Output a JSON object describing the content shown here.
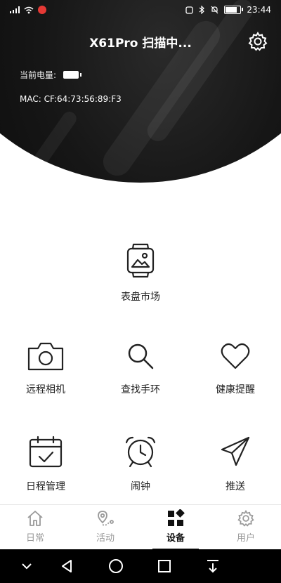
{
  "status_bar": {
    "left_icons": [
      "signal-icon",
      "wifi-icon",
      "notification-icon"
    ],
    "right_icons": [
      "nfc-icon",
      "bluetooth-icon",
      "mute-icon",
      "battery-icon"
    ],
    "time": "23:44"
  },
  "header": {
    "title": "X61Pro 扫描中...",
    "battery_label": "当前电量:",
    "mac": "MAC: CF:64:73:56:89:F3"
  },
  "features": [
    {
      "label": "表盘市场",
      "icon": "watch-face-icon"
    },
    {
      "label": "远程相机",
      "icon": "camera-icon"
    },
    {
      "label": "查找手环",
      "icon": "search-icon"
    },
    {
      "label": "健康提醒",
      "icon": "heart-icon"
    },
    {
      "label": "日程管理",
      "icon": "calendar-icon"
    },
    {
      "label": "闹钟",
      "icon": "alarm-clock-icon"
    },
    {
      "label": "推送",
      "icon": "send-icon"
    }
  ],
  "tabs": [
    {
      "label": "日常",
      "icon": "home-icon",
      "active": false
    },
    {
      "label": "活动",
      "icon": "route-icon",
      "active": false
    },
    {
      "label": "设备",
      "icon": "device-grid-icon",
      "active": true
    },
    {
      "label": "用户",
      "icon": "gear-icon",
      "active": false
    }
  ],
  "nav": [
    "chevron-down-icon",
    "back-icon",
    "home-circle-icon",
    "recents-icon",
    "download-icon"
  ]
}
